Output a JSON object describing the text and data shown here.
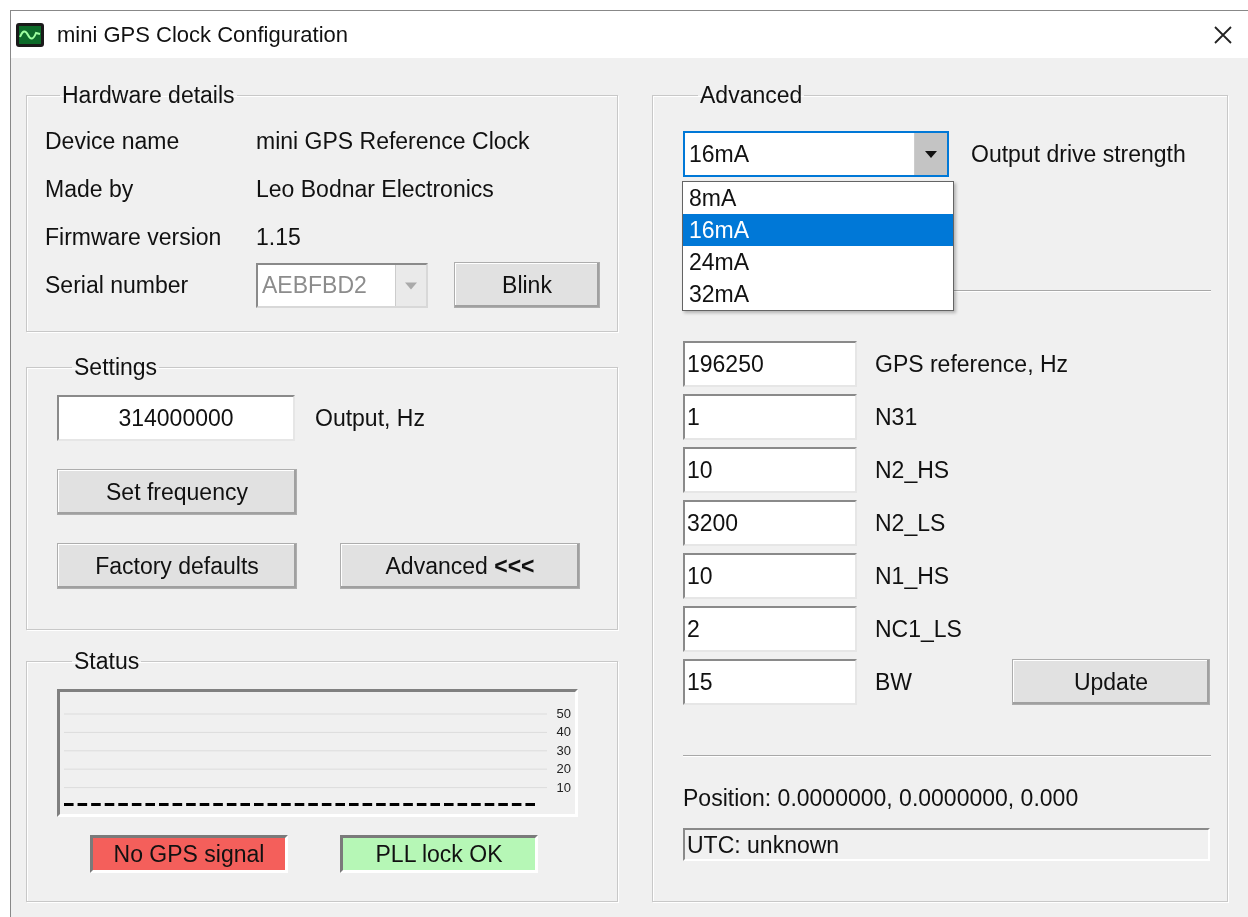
{
  "window": {
    "title": "mini GPS Clock Configuration"
  },
  "hardware_details": {
    "title": "Hardware details",
    "rows": [
      {
        "label": "Device name",
        "value": "mini GPS Reference Clock"
      },
      {
        "label": "Made by",
        "value": "Leo Bodnar Electronics"
      },
      {
        "label": "Firmware version",
        "value": "1.15"
      }
    ],
    "serial": {
      "label": "Serial number",
      "value": "AEBFBD2",
      "disabled": true
    },
    "blink_button": "Blink"
  },
  "settings": {
    "title": "Settings",
    "output": {
      "value": "314000000",
      "label": "Output, Hz"
    },
    "buttons": [
      "Set frequency",
      "Factory defaults",
      "Advanced **<<<**"
    ]
  },
  "status": {
    "title": "Status",
    "chart_data": {
      "type": "bar",
      "grid": true,
      "ylim": [
        0,
        50
      ],
      "yticks": [
        10,
        20,
        30,
        40,
        50
      ],
      "values": [
        0,
        0,
        0,
        0,
        0,
        0,
        0,
        0,
        0,
        0,
        0,
        0,
        0,
        0,
        0,
        0,
        0,
        0,
        0,
        0,
        0,
        0,
        0,
        0,
        0,
        0,
        0,
        0,
        0,
        0,
        0,
        0,
        0,
        0,
        0
      ]
    },
    "indicators": [
      {
        "text": "No GPS signal",
        "color": "#f45f5b"
      },
      {
        "text": "PLL lock OK",
        "color": "#b6f7b6"
      }
    ]
  },
  "advanced": {
    "title": "Advanced",
    "drive_strength": {
      "value": "16mA",
      "label": "Output drive strength",
      "expanded": true,
      "options": [
        {
          "text": "8mA",
          "selected": false
        },
        {
          "text": "16mA",
          "selected": true
        },
        {
          "text": "24mA",
          "selected": false
        },
        {
          "text": "32mA",
          "selected": false
        }
      ]
    },
    "fields": [
      {
        "value": "196250",
        "label": "GPS reference, Hz"
      },
      {
        "value": "1",
        "label": "N31"
      },
      {
        "value": "10",
        "label": "N2_HS"
      },
      {
        "value": "3200",
        "label": "N2_LS"
      },
      {
        "value": "10",
        "label": "N1_HS"
      },
      {
        "value": "2",
        "label": "NC1_LS"
      },
      {
        "value": "15",
        "label": "BW"
      }
    ],
    "update_button": "Update",
    "position": "Position: 0.0000000, 0.0000000, 0.000",
    "utc": "UTC: unknown"
  }
}
